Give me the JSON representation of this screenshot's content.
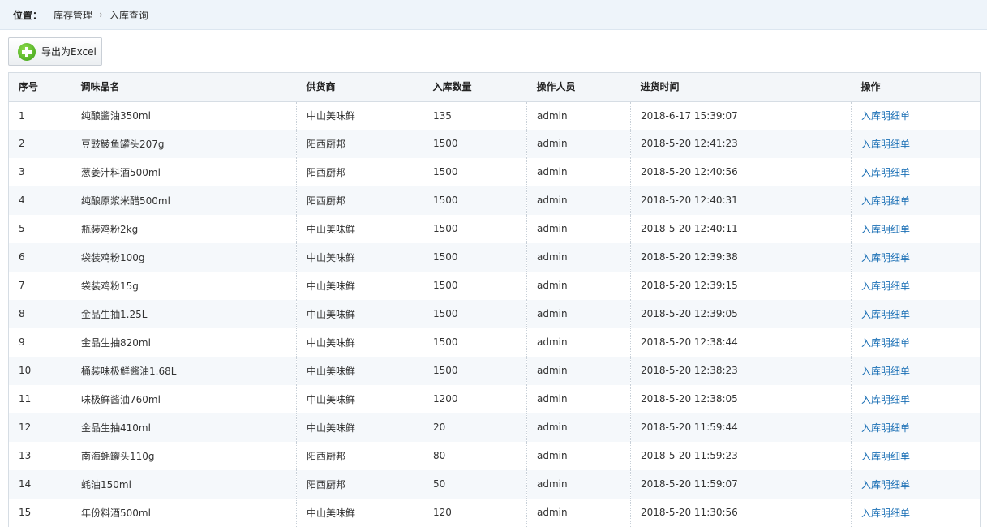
{
  "breadcrumb": {
    "location_label": "位置：",
    "items": [
      "库存管理",
      "入库查询"
    ]
  },
  "toolbar": {
    "export_label": "导出为Excel"
  },
  "table": {
    "columns": [
      "序号",
      "调味品名",
      "供货商",
      "入库数量",
      "操作人员",
      "进货时间",
      "操作"
    ],
    "rows": [
      [
        "1",
        "纯酿酱油350ml",
        "中山美味鲜",
        "135",
        "admin",
        "2018-6-17 15:39:07",
        "入库明细单"
      ],
      [
        "2",
        "豆豉鲮鱼罐头207g",
        "阳西厨邦",
        "1500",
        "admin",
        "2018-5-20 12:41:23",
        "入库明细单"
      ],
      [
        "3",
        "葱姜汁料酒500ml",
        "阳西厨邦",
        "1500",
        "admin",
        "2018-5-20 12:40:56",
        "入库明细单"
      ],
      [
        "4",
        "纯酿原浆米醋500ml",
        "阳西厨邦",
        "1500",
        "admin",
        "2018-5-20 12:40:31",
        "入库明细单"
      ],
      [
        "5",
        "瓶装鸡粉2kg",
        "中山美味鲜",
        "1500",
        "admin",
        "2018-5-20 12:40:11",
        "入库明细单"
      ],
      [
        "6",
        "袋装鸡粉100g",
        "中山美味鲜",
        "1500",
        "admin",
        "2018-5-20 12:39:38",
        "入库明细单"
      ],
      [
        "7",
        "袋装鸡粉15g",
        "中山美味鲜",
        "1500",
        "admin",
        "2018-5-20 12:39:15",
        "入库明细单"
      ],
      [
        "8",
        "金品生抽1.25L",
        "中山美味鲜",
        "1500",
        "admin",
        "2018-5-20 12:39:05",
        "入库明细单"
      ],
      [
        "9",
        "金品生抽820ml",
        "中山美味鲜",
        "1500",
        "admin",
        "2018-5-20 12:38:44",
        "入库明细单"
      ],
      [
        "10",
        "桶装味极鲜酱油1.68L",
        "中山美味鲜",
        "1500",
        "admin",
        "2018-5-20 12:38:23",
        "入库明细单"
      ],
      [
        "11",
        "味极鲜酱油760ml",
        "中山美味鲜",
        "1200",
        "admin",
        "2018-5-20 12:38:05",
        "入库明细单"
      ],
      [
        "12",
        "金品生抽410ml",
        "中山美味鲜",
        "20",
        "admin",
        "2018-5-20 11:59:44",
        "入库明细单"
      ],
      [
        "13",
        "南海蚝罐头110g",
        "阳西厨邦",
        "80",
        "admin",
        "2018-5-20 11:59:23",
        "入库明细单"
      ],
      [
        "14",
        "蚝油150ml",
        "阳西厨邦",
        "50",
        "admin",
        "2018-5-20 11:59:07",
        "入库明细单"
      ],
      [
        "15",
        "年份料酒500ml",
        "中山美味鲜",
        "120",
        "admin",
        "2018-5-20 11:30:56",
        "入库明细单"
      ]
    ]
  },
  "colors": {
    "link": "#1a6fb5",
    "header_bg": "#eef4fa",
    "row_alt": "#f5f8fb"
  }
}
